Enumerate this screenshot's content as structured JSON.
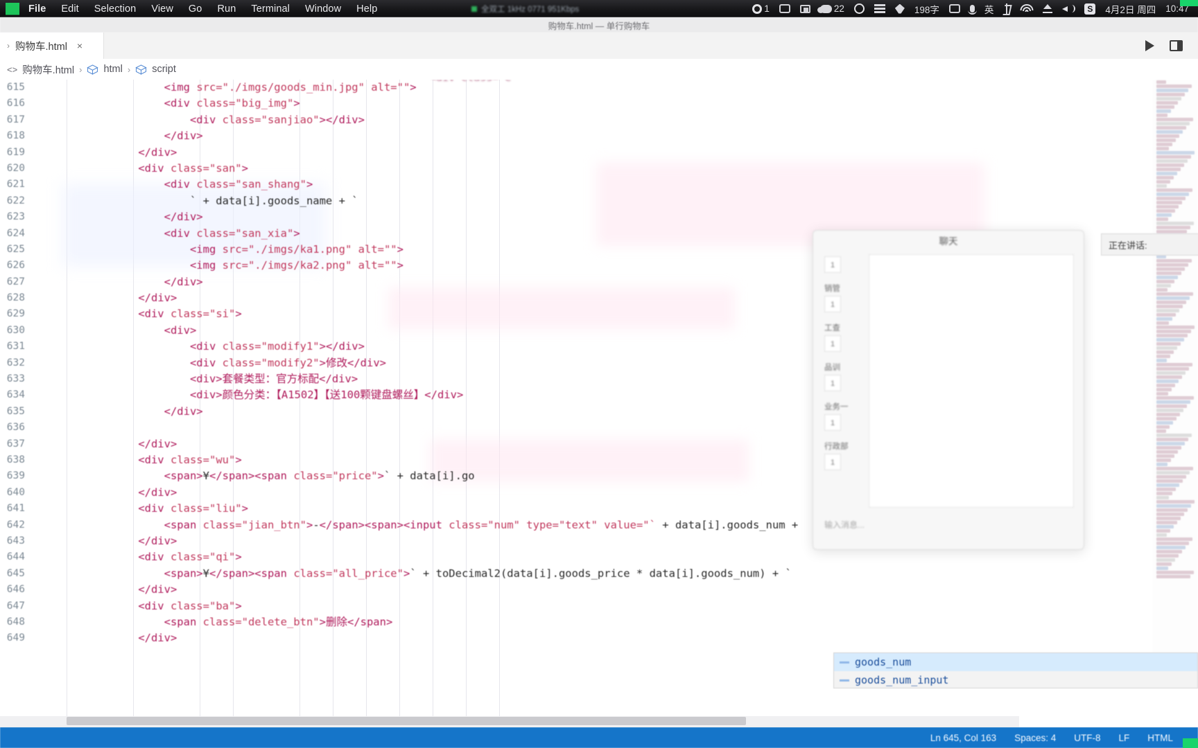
{
  "macbar": {
    "menus": [
      "File",
      "Edit",
      "Selection",
      "View",
      "Go",
      "Run",
      "Terminal",
      "Window",
      "Help"
    ],
    "center_status": "全双工 1kHz 0771 951Kbps",
    "right_items": [
      {
        "icon": "screen-record-icon",
        "label": "1"
      },
      {
        "icon": "calendar-icon",
        "label": ""
      },
      {
        "icon": "screenshot-icon",
        "label": ""
      },
      {
        "icon": "cloud-icon",
        "label": "22"
      },
      {
        "icon": "circle-icon",
        "label": ""
      },
      {
        "icon": "stack-icon",
        "label": ""
      },
      {
        "icon": "leaf-icon",
        "label": ""
      },
      {
        "icon": "ime-count-icon",
        "label": "198字"
      },
      {
        "icon": "control-center-icon",
        "label": ""
      },
      {
        "icon": "microphone-icon",
        "label": ""
      },
      {
        "icon": "input-source-icon",
        "label": "英"
      },
      {
        "icon": "bluetooth-icon",
        "label": ""
      },
      {
        "icon": "wifi-icon",
        "label": ""
      },
      {
        "icon": "eject-icon",
        "label": ""
      },
      {
        "icon": "volume-icon",
        "label": ""
      },
      {
        "icon": "sogou-icon",
        "label": "S"
      }
    ],
    "date": "4月2日 周四",
    "time": "10:47"
  },
  "window": {
    "title": "购物车.html — 单行购物车"
  },
  "tab": {
    "chevron": "›",
    "filename": "购物车.html",
    "close_icon": "×",
    "run_icon": "run-icon",
    "layout_icon": "layout-icon"
  },
  "breadcrumb": {
    "file_icon": "<>",
    "file": "购物车.html",
    "sep": "›",
    "crumbs": [
      "html",
      "script"
    ]
  },
  "editor": {
    "first_line": 615,
    "lines": [
      {
        "n": 615,
        "indent": 5,
        "segs": [
          {
            "t": "tag",
            "v": "<img "
          },
          {
            "t": "attr",
            "v": "src="
          },
          {
            "t": "str",
            "v": "\"./imgs/goods_min.jpg\""
          },
          {
            "t": "attr",
            "v": " alt="
          },
          {
            "t": "str",
            "v": "\"\""
          },
          {
            "t": "tag",
            "v": ">"
          }
        ]
      },
      {
        "n": 616,
        "indent": 5,
        "segs": [
          {
            "t": "tag",
            "v": "<div "
          },
          {
            "t": "attr",
            "v": "class="
          },
          {
            "t": "str",
            "v": "\"big_img\""
          },
          {
            "t": "tag",
            "v": ">"
          }
        ]
      },
      {
        "n": 617,
        "indent": 6,
        "segs": [
          {
            "t": "tag",
            "v": "<div "
          },
          {
            "t": "attr",
            "v": "class="
          },
          {
            "t": "str",
            "v": "\"sanjiao\""
          },
          {
            "t": "tag",
            "v": "></div>"
          }
        ]
      },
      {
        "n": 618,
        "indent": 5,
        "segs": [
          {
            "t": "tag",
            "v": "</div>"
          }
        ]
      },
      {
        "n": 619,
        "indent": 4,
        "segs": [
          {
            "t": "tag",
            "v": "</div>"
          }
        ]
      },
      {
        "n": 620,
        "indent": 4,
        "segs": [
          {
            "t": "tag",
            "v": "<div "
          },
          {
            "t": "attr",
            "v": "class="
          },
          {
            "t": "str",
            "v": "\"san\""
          },
          {
            "t": "tag",
            "v": ">"
          }
        ]
      },
      {
        "n": 621,
        "indent": 5,
        "segs": [
          {
            "t": "tag",
            "v": "<div "
          },
          {
            "t": "attr",
            "v": "class="
          },
          {
            "t": "str",
            "v": "\"san_shang\""
          },
          {
            "t": "tag",
            "v": ">"
          }
        ]
      },
      {
        "n": 622,
        "indent": 6,
        "segs": [
          {
            "t": "js",
            "v": "` + data[i].goods_name + `"
          }
        ]
      },
      {
        "n": 623,
        "indent": 5,
        "segs": [
          {
            "t": "tag",
            "v": "</div>"
          }
        ]
      },
      {
        "n": 624,
        "indent": 5,
        "segs": [
          {
            "t": "tag",
            "v": "<div "
          },
          {
            "t": "attr",
            "v": "class="
          },
          {
            "t": "str",
            "v": "\"san_xia\""
          },
          {
            "t": "tag",
            "v": ">"
          }
        ]
      },
      {
        "n": 625,
        "indent": 6,
        "segs": [
          {
            "t": "tag",
            "v": "<img "
          },
          {
            "t": "attr",
            "v": "src="
          },
          {
            "t": "str",
            "v": "\"./imgs/ka1.png\""
          },
          {
            "t": "attr",
            "v": " alt="
          },
          {
            "t": "str",
            "v": "\"\""
          },
          {
            "t": "tag",
            "v": ">"
          }
        ]
      },
      {
        "n": 626,
        "indent": 6,
        "segs": [
          {
            "t": "tag",
            "v": "<img "
          },
          {
            "t": "attr",
            "v": "src="
          },
          {
            "t": "str",
            "v": "\"./imgs/ka2.png\""
          },
          {
            "t": "attr",
            "v": " alt="
          },
          {
            "t": "str",
            "v": "\"\""
          },
          {
            "t": "tag",
            "v": ">"
          }
        ]
      },
      {
        "n": 627,
        "indent": 5,
        "segs": [
          {
            "t": "tag",
            "v": "</div>"
          }
        ]
      },
      {
        "n": 628,
        "indent": 4,
        "segs": [
          {
            "t": "tag",
            "v": "</div>"
          }
        ]
      },
      {
        "n": 629,
        "indent": 4,
        "segs": [
          {
            "t": "tag",
            "v": "<div "
          },
          {
            "t": "attr",
            "v": "class="
          },
          {
            "t": "str",
            "v": "\"si\""
          },
          {
            "t": "tag",
            "v": ">"
          }
        ]
      },
      {
        "n": 630,
        "indent": 5,
        "segs": [
          {
            "t": "tag",
            "v": "<div>"
          }
        ]
      },
      {
        "n": 631,
        "indent": 6,
        "segs": [
          {
            "t": "tag",
            "v": "<div "
          },
          {
            "t": "attr",
            "v": "class="
          },
          {
            "t": "str",
            "v": "\"modify1\""
          },
          {
            "t": "tag",
            "v": "></div>"
          }
        ]
      },
      {
        "n": 632,
        "indent": 6,
        "segs": [
          {
            "t": "tag",
            "v": "<div "
          },
          {
            "t": "attr",
            "v": "class="
          },
          {
            "t": "str",
            "v": "\"modify2\""
          },
          {
            "t": "tag",
            "v": ">"
          },
          {
            "t": "cn",
            "v": "修改"
          },
          {
            "t": "tag",
            "v": "</div>"
          }
        ]
      },
      {
        "n": 633,
        "indent": 6,
        "segs": [
          {
            "t": "tag",
            "v": "<div>"
          },
          {
            "t": "cn",
            "v": "套餐类型：官方标配"
          },
          {
            "t": "tag",
            "v": "</div>"
          }
        ]
      },
      {
        "n": 634,
        "indent": 6,
        "segs": [
          {
            "t": "tag",
            "v": "<div>"
          },
          {
            "t": "cn",
            "v": "颜色分类：【A1502】【送100颗键盘螺丝】"
          },
          {
            "t": "tag",
            "v": "</div>"
          }
        ]
      },
      {
        "n": 635,
        "indent": 5,
        "segs": [
          {
            "t": "tag",
            "v": "</div>"
          }
        ]
      },
      {
        "n": 636,
        "indent": 0,
        "segs": []
      },
      {
        "n": 637,
        "indent": 4,
        "segs": [
          {
            "t": "tag",
            "v": "</div>"
          }
        ]
      },
      {
        "n": 638,
        "indent": 4,
        "segs": [
          {
            "t": "tag",
            "v": "<div "
          },
          {
            "t": "attr",
            "v": "class="
          },
          {
            "t": "str",
            "v": "\"wu\""
          },
          {
            "t": "tag",
            "v": ">"
          }
        ]
      },
      {
        "n": 639,
        "indent": 5,
        "segs": [
          {
            "t": "tag",
            "v": "<span>"
          },
          {
            "t": "plain",
            "v": "¥"
          },
          {
            "t": "tag",
            "v": "</span><span "
          },
          {
            "t": "attr",
            "v": "class="
          },
          {
            "t": "str",
            "v": "\"price\""
          },
          {
            "t": "tag",
            "v": ">"
          },
          {
            "t": "js",
            "v": "` + data[i].go"
          }
        ]
      },
      {
        "n": 640,
        "indent": 4,
        "segs": [
          {
            "t": "tag",
            "v": "</div>"
          }
        ]
      },
      {
        "n": 641,
        "indent": 4,
        "segs": [
          {
            "t": "tag",
            "v": "<div "
          },
          {
            "t": "attr",
            "v": "class="
          },
          {
            "t": "str",
            "v": "\"liu\""
          },
          {
            "t": "tag",
            "v": ">"
          }
        ]
      },
      {
        "n": 642,
        "indent": 5,
        "segs": [
          {
            "t": "tag",
            "v": "<span "
          },
          {
            "t": "attr",
            "v": "class="
          },
          {
            "t": "str",
            "v": "\"jian_btn\""
          },
          {
            "t": "tag",
            "v": ">"
          },
          {
            "t": "plain",
            "v": "-"
          },
          {
            "t": "tag",
            "v": "</span><span><input "
          },
          {
            "t": "attr",
            "v": "class="
          },
          {
            "t": "str",
            "v": "\"num\""
          },
          {
            "t": "attr",
            "v": " type="
          },
          {
            "t": "str",
            "v": "\"text\""
          },
          {
            "t": "attr",
            "v": " value="
          },
          {
            "t": "str",
            "v": "\"`"
          },
          {
            "t": "js",
            "v": " + data[i].goods_num +"
          }
        ]
      },
      {
        "n": 643,
        "indent": 4,
        "segs": [
          {
            "t": "tag",
            "v": "</div>"
          }
        ]
      },
      {
        "n": 644,
        "indent": 4,
        "segs": [
          {
            "t": "tag",
            "v": "<div "
          },
          {
            "t": "attr",
            "v": "class="
          },
          {
            "t": "str",
            "v": "\"qi\""
          },
          {
            "t": "tag",
            "v": ">"
          }
        ]
      },
      {
        "n": 645,
        "indent": 5,
        "segs": [
          {
            "t": "tag",
            "v": "<span>"
          },
          {
            "t": "plain",
            "v": "¥"
          },
          {
            "t": "tag",
            "v": "</span><span "
          },
          {
            "t": "attr",
            "v": "class="
          },
          {
            "t": "str",
            "v": "\"all_price\""
          },
          {
            "t": "tag",
            "v": ">"
          },
          {
            "t": "js",
            "v": "` + toDecimal2(data[i].goods_price * data[i].goods_num) + `"
          }
        ]
      },
      {
        "n": 646,
        "indent": 4,
        "segs": [
          {
            "t": "tag",
            "v": "</div>"
          }
        ]
      },
      {
        "n": 647,
        "indent": 4,
        "segs": [
          {
            "t": "tag",
            "v": "<div "
          },
          {
            "t": "attr",
            "v": "class="
          },
          {
            "t": "str",
            "v": "\"ba\""
          },
          {
            "t": "tag",
            "v": ">"
          }
        ]
      },
      {
        "n": 648,
        "indent": 5,
        "segs": [
          {
            "t": "tag",
            "v": "<span "
          },
          {
            "t": "attr",
            "v": "class="
          },
          {
            "t": "str",
            "v": "\"delete_btn\""
          },
          {
            "t": "tag",
            "v": ">"
          },
          {
            "t": "cn",
            "v": "删除"
          },
          {
            "t": "tag",
            "v": "</span>"
          }
        ]
      },
      {
        "n": 649,
        "indent": 4,
        "segs": [
          {
            "t": "tag",
            "v": "</div>"
          }
        ]
      }
    ]
  },
  "autocomplete": {
    "items": [
      {
        "label": "goods_num",
        "selected": true
      },
      {
        "label": "goods_num_input",
        "selected": false
      }
    ]
  },
  "chat": {
    "title": "聊天",
    "groups": [
      {
        "name": "",
        "value": "1"
      },
      {
        "name": "销管",
        "value": "1"
      },
      {
        "name": "工查",
        "value": "1"
      },
      {
        "name": "品训",
        "value": "1"
      },
      {
        "name": "业务一",
        "value": "1"
      },
      {
        "name": "行政部",
        "value": "1"
      }
    ],
    "input_placeholder": "输入消息..."
  },
  "speaking": {
    "label": "正在讲话:"
  },
  "statusbar": {
    "position": "Ln 645, Col 163",
    "spaces": "Spaces: 4",
    "encoding": "UTF-8",
    "eol": "LF",
    "language": "HTML"
  },
  "colors": {
    "status_blue": "#1575c9",
    "tag_pink": "#b01c5c",
    "selection_blue": "#d6ebfd",
    "accent_green": "#19d46b"
  }
}
